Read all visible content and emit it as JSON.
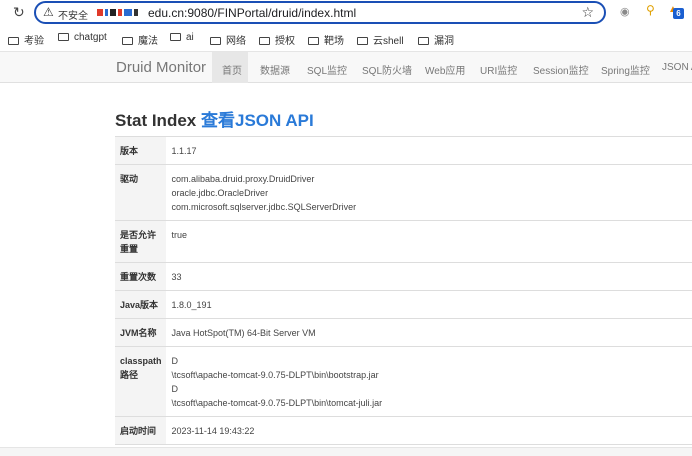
{
  "browser": {
    "insecure_label": "不安全",
    "url": "edu.cn:9080/FINPortal/druid/index.html",
    "extension_badge": "6"
  },
  "bookmarks": [
    {
      "label": "考验"
    },
    {
      "label": "chatgpt"
    },
    {
      "label": "魔法"
    },
    {
      "label": "ai"
    },
    {
      "label": "网络"
    },
    {
      "label": "授权"
    },
    {
      "label": "靶场"
    },
    {
      "label": "云shell"
    },
    {
      "label": "漏洞"
    }
  ],
  "navbar": {
    "brand": "Druid Monitor",
    "items": [
      {
        "label": "首页"
      },
      {
        "label": "数据源"
      },
      {
        "label": "SQL监控"
      },
      {
        "label": "SQL防火墙"
      },
      {
        "label": "Web应用"
      },
      {
        "label": "URI监控"
      },
      {
        "label": "Session监控"
      },
      {
        "label": "Spring监控"
      },
      {
        "label": "JSON A"
      }
    ]
  },
  "page": {
    "title": "Stat Index",
    "json_link": "查看JSON API"
  },
  "stats": [
    {
      "key": "版本",
      "lines": [
        "1.1.17"
      ]
    },
    {
      "key": "驱动",
      "lines": [
        "com.alibaba.druid.proxy.DruidDriver",
        "oracle.jdbc.OracleDriver",
        "com.microsoft.sqlserver.jdbc.SQLServerDriver"
      ]
    },
    {
      "key": "是否允许重置",
      "lines": [
        "true"
      ]
    },
    {
      "key": "重置次数",
      "lines": [
        "33"
      ]
    },
    {
      "key": "Java版本",
      "lines": [
        "1.8.0_191"
      ]
    },
    {
      "key": "JVM名称",
      "lines": [
        "Java HotSpot(TM) 64-Bit Server VM"
      ]
    },
    {
      "key": "classpath路径",
      "lines": [
        "D",
        "\\tcsoft\\apache-tomcat-9.0.75-DLPT\\bin\\bootstrap.jar",
        "D",
        "\\tcsoft\\apache-tomcat-9.0.75-DLPT\\bin\\tomcat-juli.jar"
      ]
    },
    {
      "key": "启动时间",
      "lines": [
        "2023-11-14 19:43:22"
      ]
    }
  ]
}
